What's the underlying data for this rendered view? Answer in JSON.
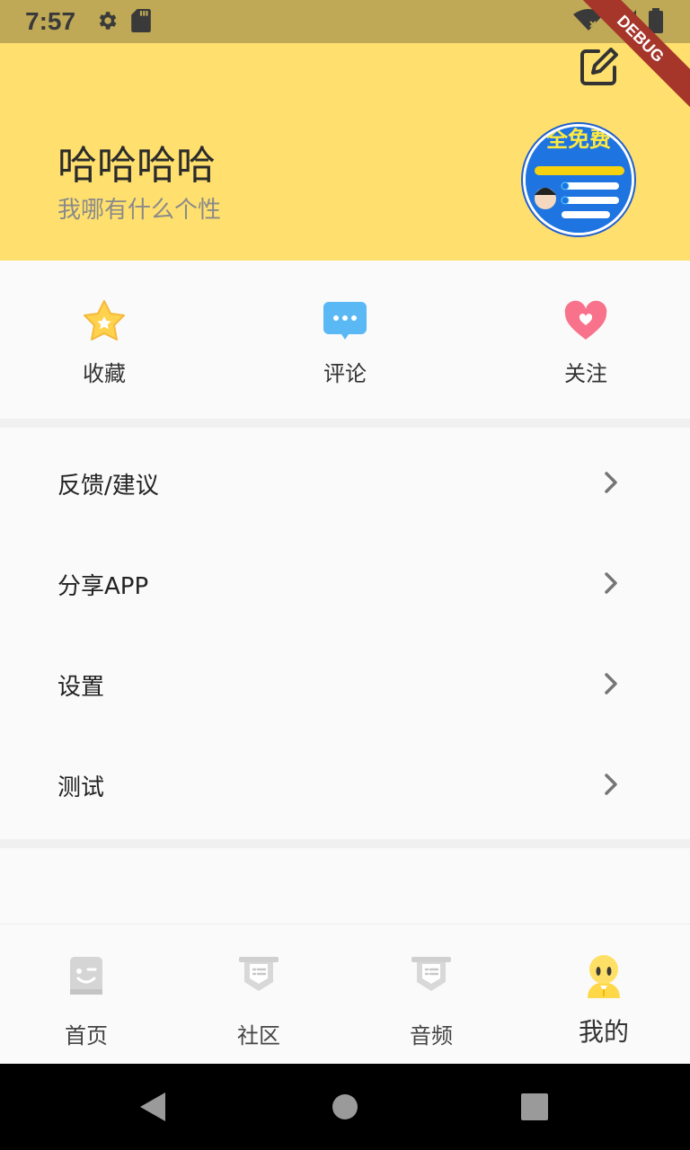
{
  "status_bar": {
    "time": "7:57",
    "icons_left": [
      "settings-icon",
      "sd-card-icon"
    ],
    "icons_right": [
      "wifi-off-icon",
      "signal-icon",
      "battery-icon"
    ]
  },
  "debug_banner": "DEBUG",
  "header": {
    "user_name": "哈哈哈哈",
    "user_bio": "我哪有什么个性",
    "edit_icon": "edit-icon",
    "avatar_text": "全免费"
  },
  "quick_actions": [
    {
      "label": "收藏",
      "icon": "star-icon"
    },
    {
      "label": "评论",
      "icon": "comment-icon"
    },
    {
      "label": "关注",
      "icon": "heart-icon"
    }
  ],
  "menu": [
    {
      "label": "反馈/建议"
    },
    {
      "label": "分享APP"
    },
    {
      "label": "设置"
    },
    {
      "label": "测试"
    }
  ],
  "bottom_nav": [
    {
      "label": "首页",
      "icon": "home-face-icon",
      "active": false
    },
    {
      "label": "社区",
      "icon": "community-icon",
      "active": false
    },
    {
      "label": "音频",
      "icon": "audio-icon",
      "active": false
    },
    {
      "label": "我的",
      "icon": "profile-icon",
      "active": true
    }
  ],
  "colors": {
    "header_bg": "#FFE06E",
    "status_bar_bg": "#BFA956",
    "debug_ribbon": "#A6352A",
    "page_bg": "#FAFAFA"
  }
}
